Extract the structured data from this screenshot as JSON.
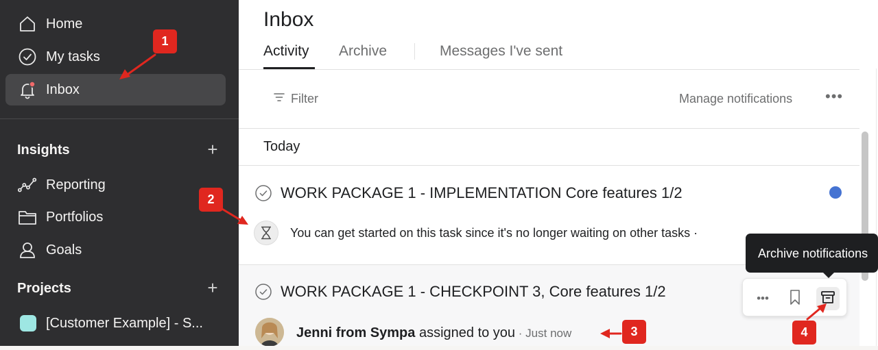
{
  "sidebar": {
    "nav": [
      {
        "label": "Home",
        "icon": "home-icon"
      },
      {
        "label": "My tasks",
        "icon": "check-circle-icon"
      },
      {
        "label": "Inbox",
        "icon": "bell-icon",
        "active": true,
        "has_notification_dot": true
      }
    ],
    "insights": {
      "heading": "Insights",
      "plus": "+",
      "items": [
        {
          "label": "Reporting",
          "icon": "reporting-icon"
        },
        {
          "label": "Portfolios",
          "icon": "folder-icon"
        },
        {
          "label": "Goals",
          "icon": "goals-icon"
        }
      ]
    },
    "projects": {
      "heading": "Projects",
      "plus": "+",
      "items": [
        {
          "label": "[Customer Example] - S...",
          "color": "#9ee7e3"
        }
      ]
    }
  },
  "main": {
    "title": "Inbox",
    "tabs": [
      {
        "label": "Activity",
        "active": true
      },
      {
        "label": "Archive"
      },
      {
        "label": "Messages I've sent"
      }
    ],
    "toolbar": {
      "filter_label": "Filter",
      "manage_label": "Manage notifications",
      "more_label": "•••"
    },
    "group_label": "Today",
    "notifications": [
      {
        "title": "WORK PACKAGE 1 - IMPLEMENTATION Core features 1/2",
        "text": "You can get started on this task since it's no longer waiting on other tasks ·",
        "unread": true
      },
      {
        "title": "WORK PACKAGE 1 - CHECKPOINT 3, Core features 1/2",
        "actor": "Jenni from Sympa",
        "action": "assigned to you",
        "separator": " · ",
        "time": "Just now"
      }
    ],
    "actions": {
      "more_label": "•••",
      "tooltip": "Archive notifications"
    }
  },
  "callouts": [
    "1",
    "2",
    "3",
    "4"
  ],
  "colors": {
    "sidebar_bg": "#2e2e30",
    "active_nav_bg": "#474749",
    "unread_dot": "#4573d2",
    "notification_dot": "#f06a6a",
    "callout_red": "#e0271f",
    "project_swatch": "#9ee7e3"
  }
}
